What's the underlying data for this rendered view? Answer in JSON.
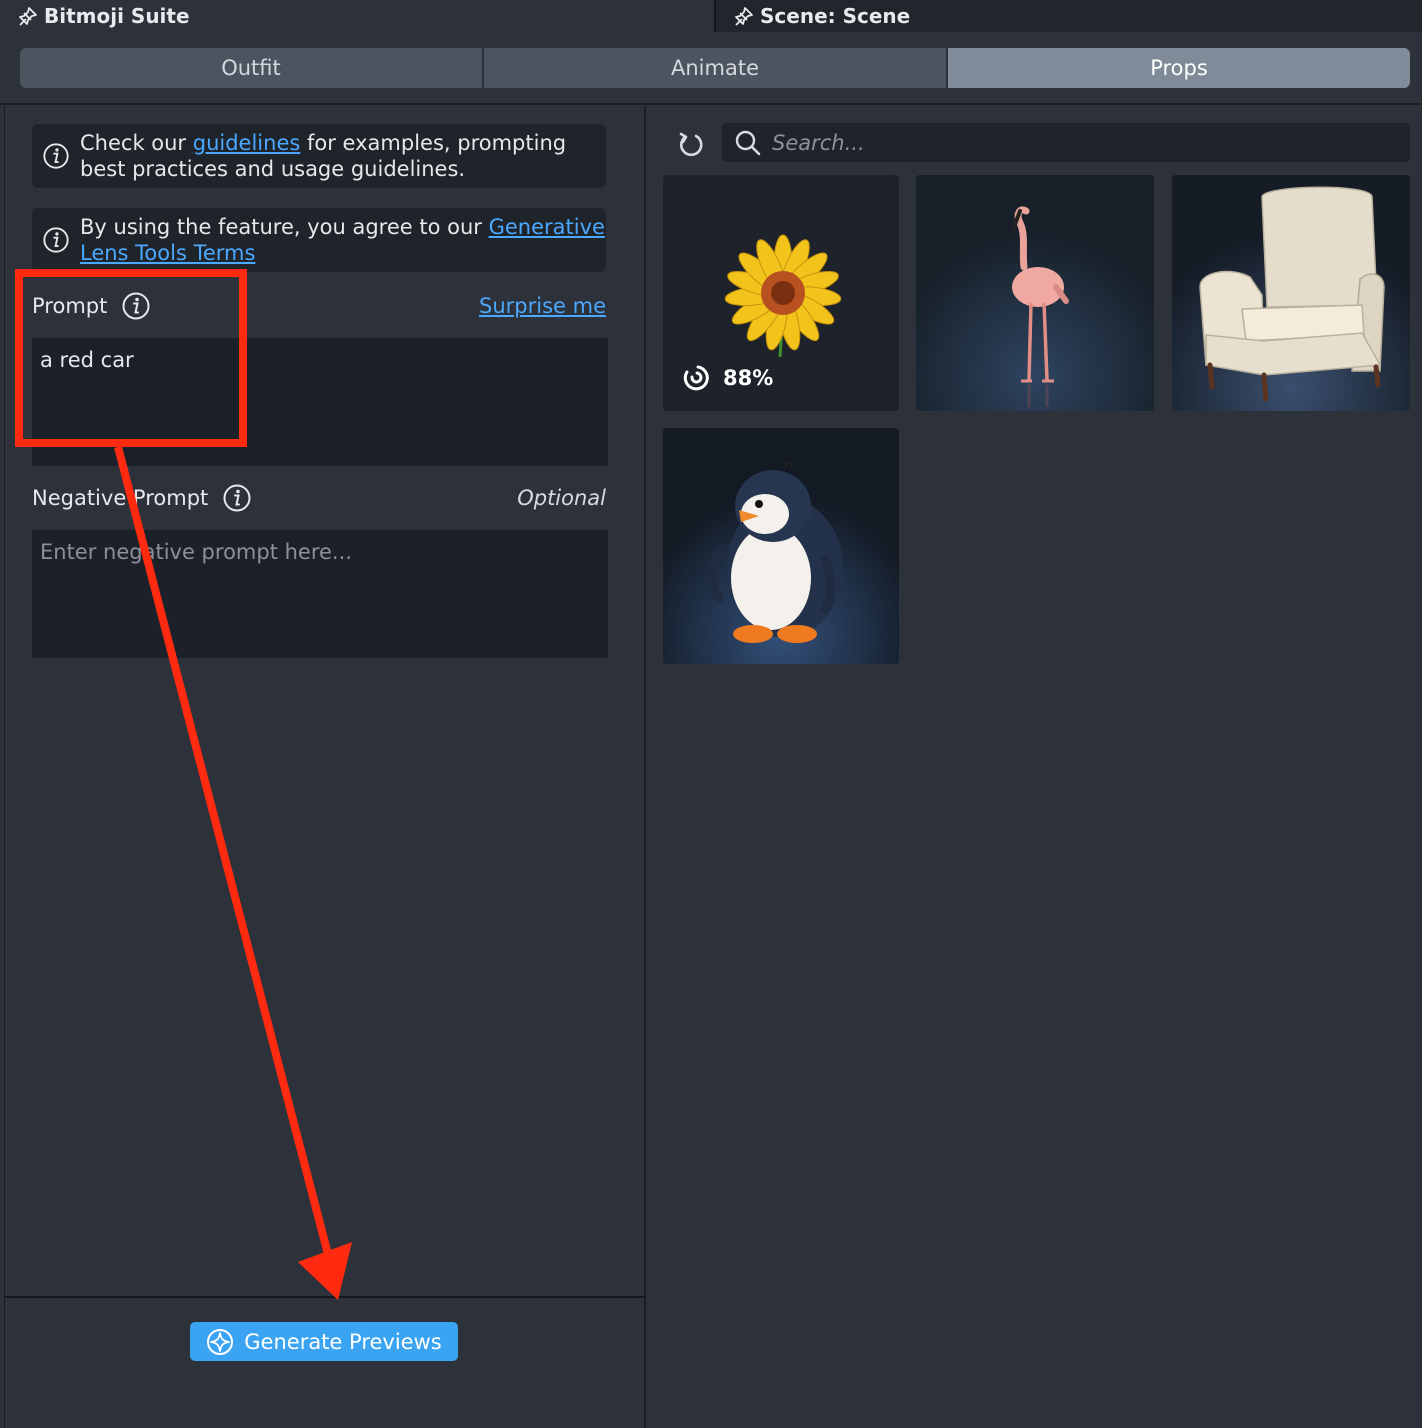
{
  "window": {
    "left_tab_title": "Bitmoji Suite",
    "right_tab_title": "Scene: Scene",
    "pin_icon": "pin-icon"
  },
  "tabs": [
    {
      "label": "Outfit",
      "active": false
    },
    {
      "label": "Animate",
      "active": false
    },
    {
      "label": "Props",
      "active": true
    }
  ],
  "info": {
    "guidelines": {
      "pre": "Check our ",
      "link": "guidelines",
      "post": " for examples, prompting best practices and usage guidelines."
    },
    "terms": {
      "pre": "By using the feature, you agree to our ",
      "link": "Generative Lens Tools Terms"
    }
  },
  "prompt": {
    "label": "Prompt",
    "surprise_link": "Surprise me",
    "value": "a red car"
  },
  "negative_prompt": {
    "label": "Negative Prompt",
    "optional": "Optional",
    "placeholder": "Enter negative prompt here..."
  },
  "generate_button": {
    "label": "Generate Previews"
  },
  "search": {
    "placeholder": "Search..."
  },
  "results": [
    {
      "name": "sunflower",
      "progress": "88%"
    },
    {
      "name": "flamingo"
    },
    {
      "name": "armchair"
    },
    {
      "name": "penguin"
    }
  ],
  "colors": {
    "accent": "#3aa3f2",
    "link": "#4aa8ff",
    "annotation": "#ff2a10",
    "active_tab": "#7f8b98"
  }
}
